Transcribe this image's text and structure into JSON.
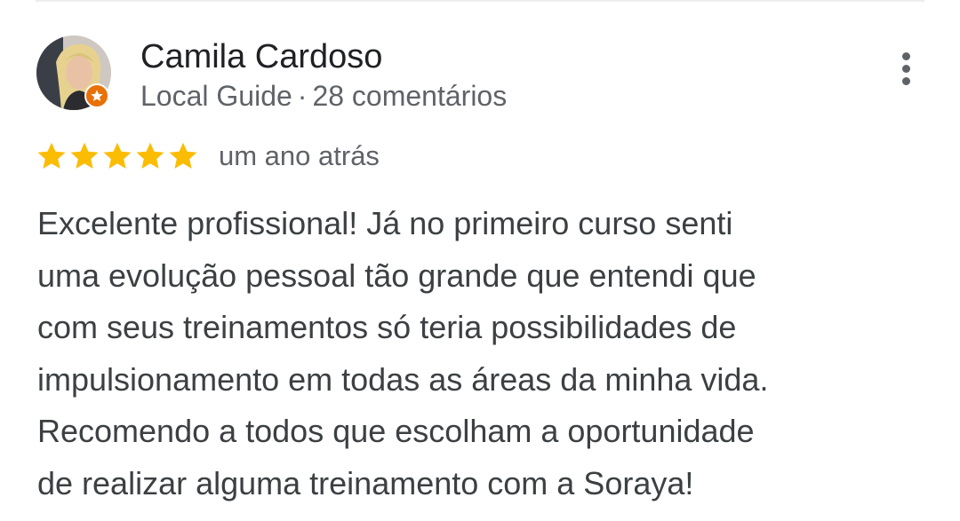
{
  "review": {
    "author": {
      "name": "Camila Cardoso",
      "badge": "Local Guide",
      "separator": "·",
      "reviews_count": "28 comentários",
      "avatar_icon": "profile-photo",
      "badge_icon": "local-guide-star-icon"
    },
    "more_icon": "more-vert-icon",
    "rating": {
      "stars": 5,
      "max": 5,
      "star_color": "#fbbc04"
    },
    "time": "um ano atrás",
    "text_lines": [
      "Excelente profissional! Já no primeiro curso senti",
      "uma evolução pessoal tão grande que entendi que",
      "com seus treinamentos só teria possibilidades de",
      "impulsionamento em todas as áreas da minha vida.",
      "Recomendo a todos que escolham a oportunidade",
      "de realizar alguma treinamento com a Soraya!"
    ]
  },
  "colors": {
    "name": "#202124",
    "secondary": "#5f6368",
    "body": "#3c4043",
    "guide_badge": "#e8710a"
  }
}
